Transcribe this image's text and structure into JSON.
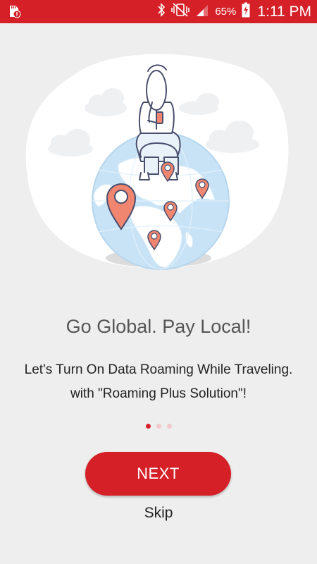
{
  "status_bar": {
    "battery_percent": "65%",
    "time": "1:11 PM",
    "icons": [
      "sd-card-alert-icon",
      "bluetooth-icon",
      "vibrate-icon",
      "signal-icon",
      "battery-charging-icon"
    ]
  },
  "illustration": {
    "subject": "globe-with-person-icon",
    "pins": [
      "map-pin-icon",
      "map-pin-icon",
      "map-pin-icon",
      "map-pin-icon",
      "map-pin-icon"
    ]
  },
  "onboarding": {
    "headline": "Go Global. Pay Local!",
    "subtitle_line1": "Let's Turn On Data Roaming While Traveling.",
    "subtitle_line2": "with \"Roaming Plus Solution\"!",
    "page_count": 3,
    "current_page": 1
  },
  "actions": {
    "next_label": "NEXT",
    "skip_label": "Skip"
  },
  "colors": {
    "brand_red": "#d52027",
    "background": "#eeeeee",
    "globe_blue": "#c7e2f5"
  }
}
